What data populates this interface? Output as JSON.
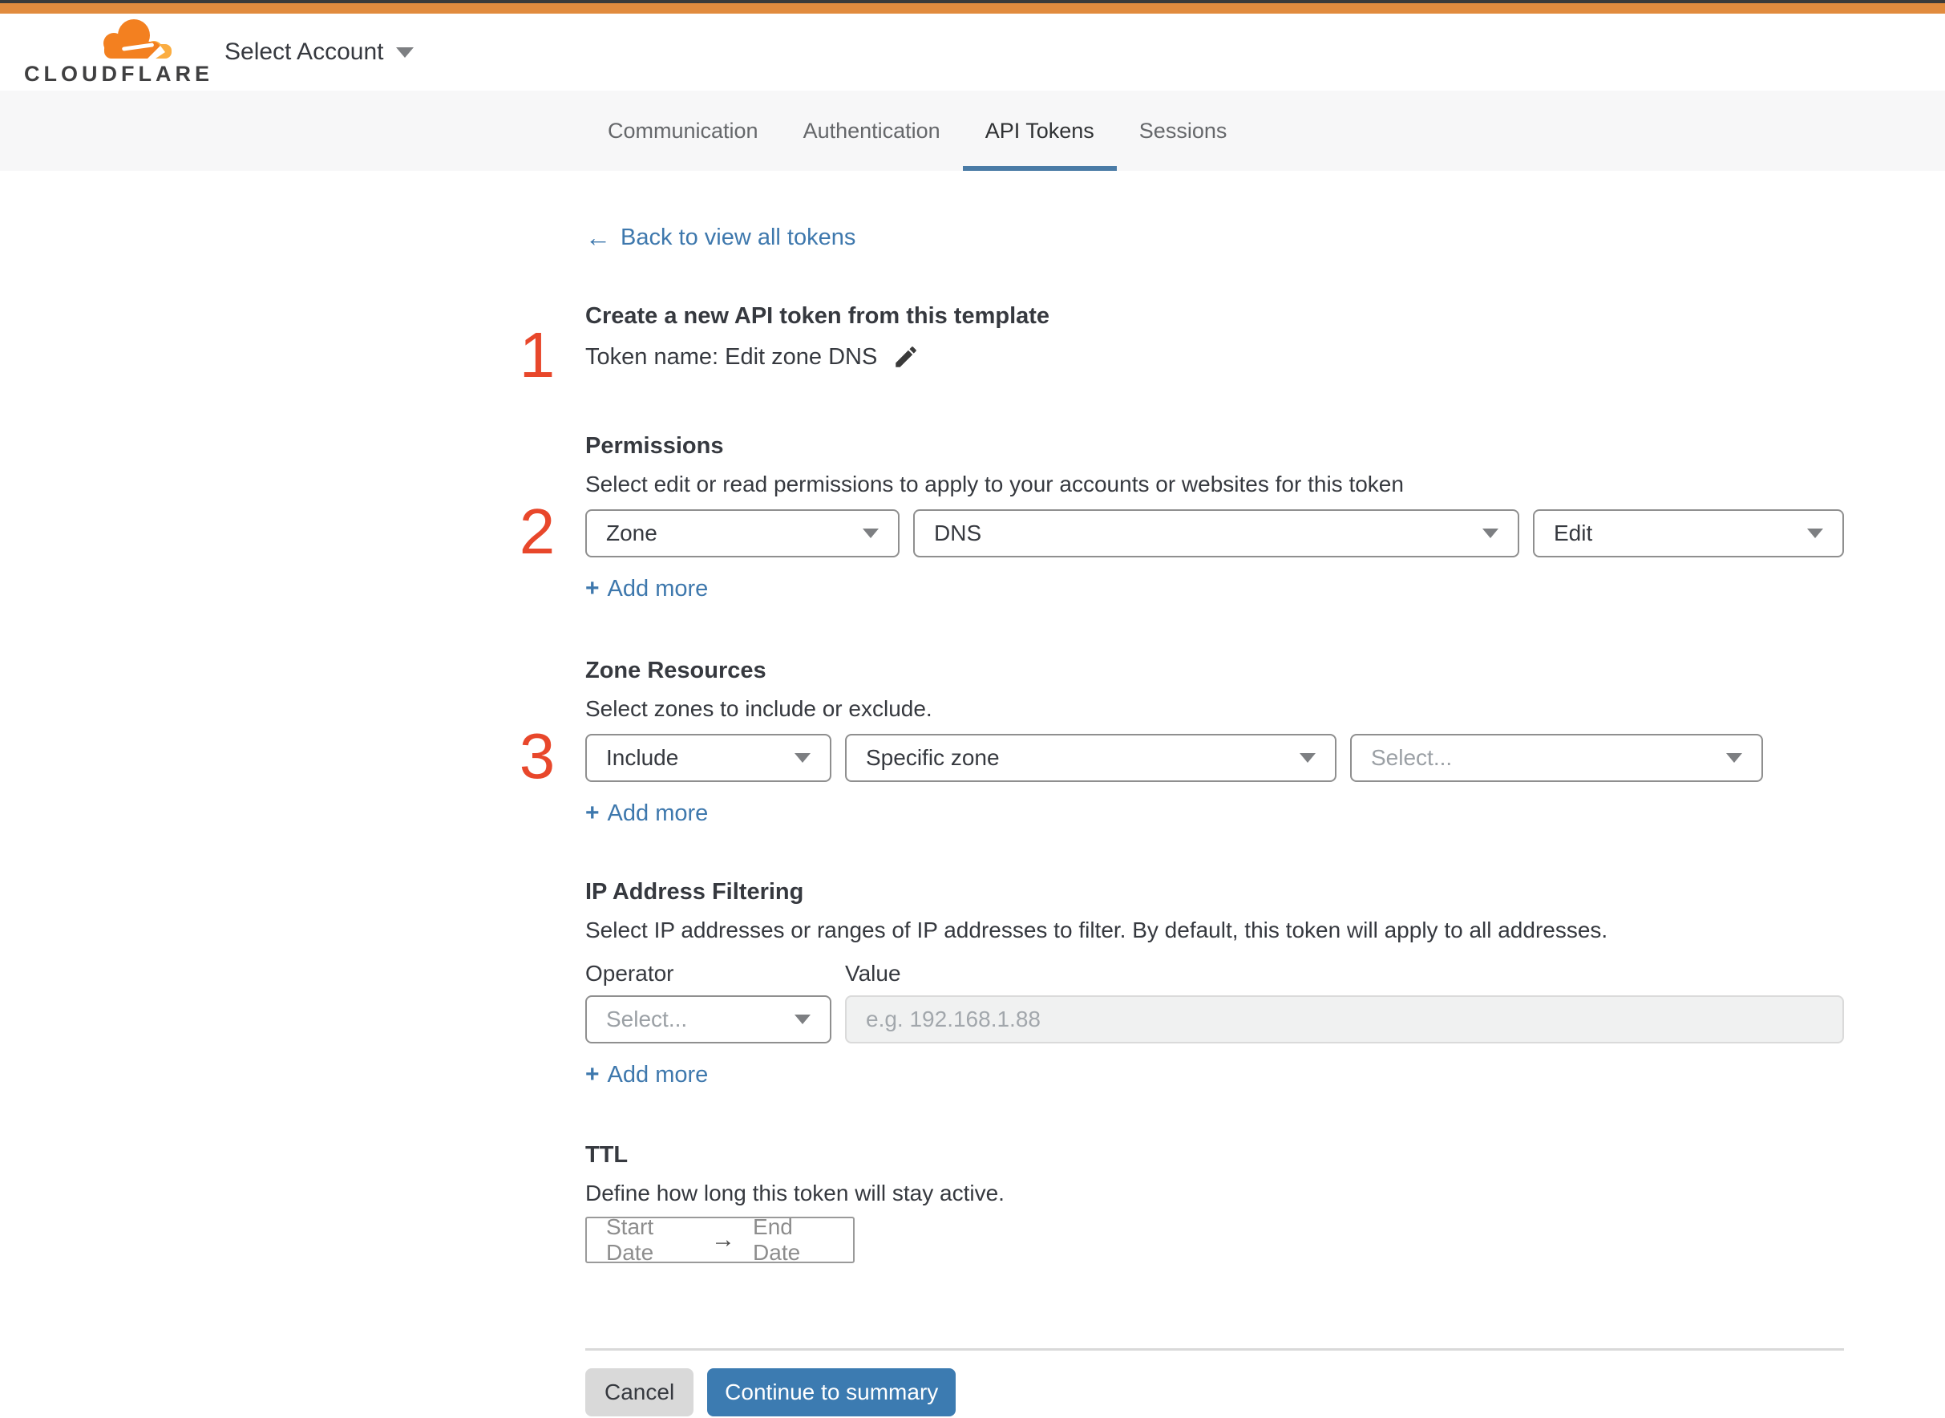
{
  "colors": {
    "brand_orange": "#e18b3e",
    "logo_cloud_orange": "#f38020",
    "logo_cloud_light": "#fbad41",
    "tab_underline_blue": "#4a7ba6",
    "link_blue": "#3e78ad",
    "button_blue": "#3c7bb1",
    "step_number_red": "#e8472b"
  },
  "icons": {
    "plus": "+",
    "back_arrow": "←",
    "range_arrow": "→"
  },
  "header": {
    "logo_text": "CLOUDFLARE",
    "account_selector_label": "Select Account"
  },
  "tabs": [
    {
      "label": "Communication"
    },
    {
      "label": "Authentication"
    },
    {
      "label": "API Tokens"
    },
    {
      "label": "Sessions"
    }
  ],
  "page": {
    "back_link_label": "Back to view all tokens",
    "create": {
      "step_number": "1",
      "heading": "Create a new API token from this template",
      "token_name_label": "Token name: Edit zone DNS"
    },
    "permissions": {
      "step_number": "2",
      "heading": "Permissions",
      "description": "Select edit or read permissions to apply to your accounts or websites for this token",
      "scope_value": "Zone",
      "resource_value": "DNS",
      "access_value": "Edit",
      "add_more_label": "Add more"
    },
    "zone_resources": {
      "step_number": "3",
      "heading": "Zone Resources",
      "description": "Select zones to include or exclude.",
      "mode_value": "Include",
      "type_value": "Specific zone",
      "zone_placeholder": "Select...",
      "add_more_label": "Add more"
    },
    "ip_filtering": {
      "heading": "IP Address Filtering",
      "description": "Select IP addresses or ranges of IP addresses to filter. By default, this token will apply to all addresses.",
      "operator_label": "Operator",
      "value_label": "Value",
      "operator_placeholder": "Select...",
      "value_placeholder": "e.g. 192.168.1.88",
      "add_more_label": "Add more"
    },
    "ttl": {
      "heading": "TTL",
      "description": "Define how long this token will stay active.",
      "start_date_label": "Start Date",
      "end_date_label": "End Date"
    },
    "footer": {
      "cancel_label": "Cancel",
      "continue_label": "Continue to summary"
    }
  }
}
